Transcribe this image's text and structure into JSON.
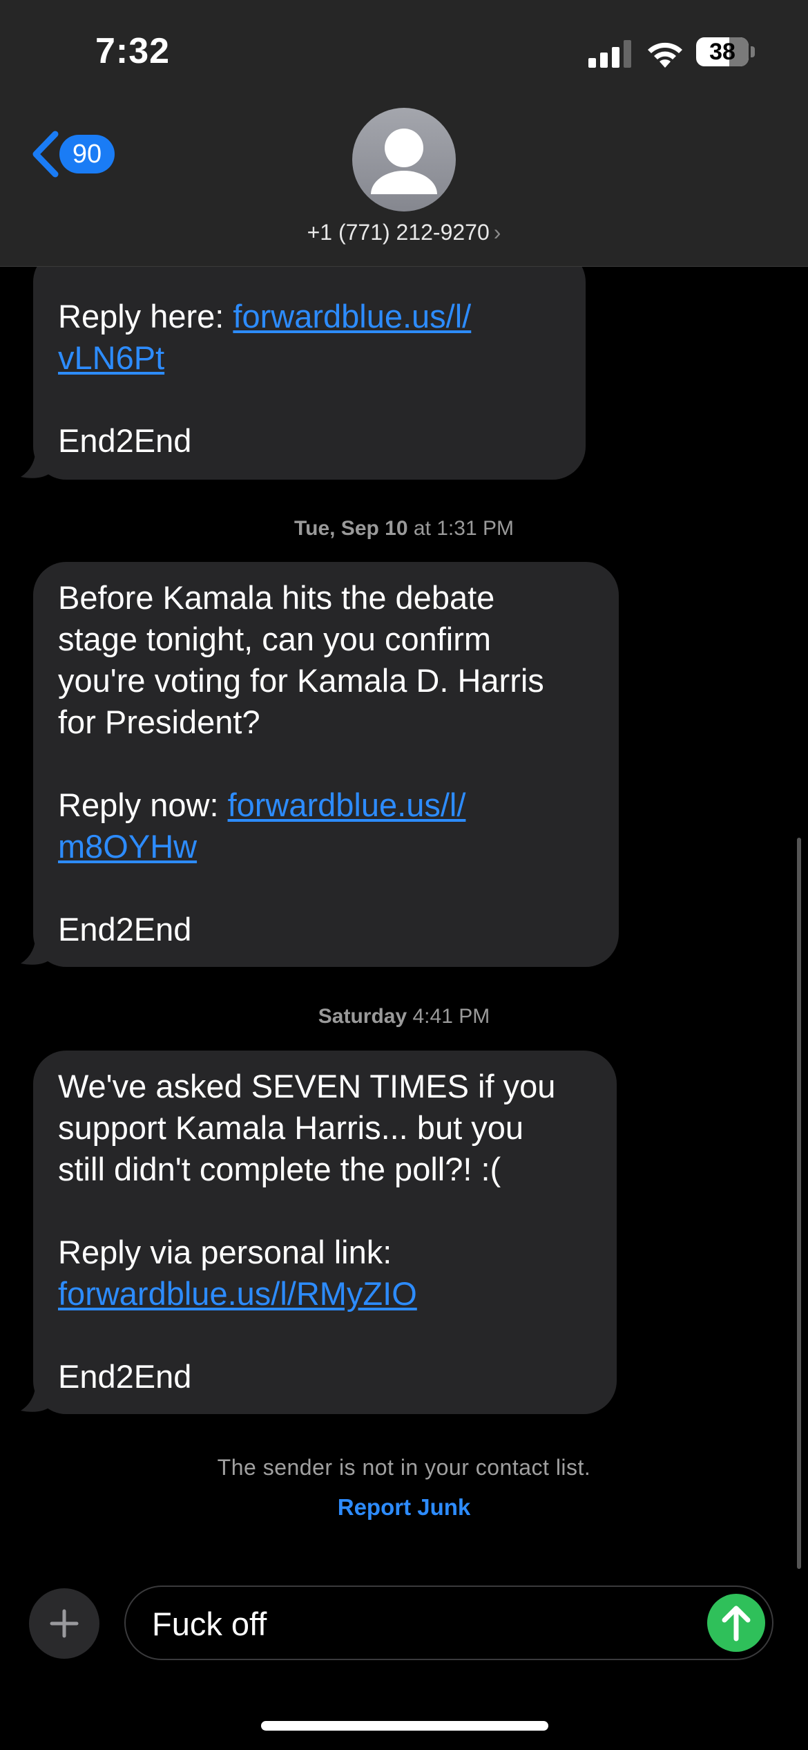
{
  "status_bar": {
    "time": "7:32",
    "battery": "38"
  },
  "header": {
    "back_badge": "90",
    "contact": "+1 (771) 212-9270",
    "contact_chevron": "›"
  },
  "messages": [
    {
      "lines": [
        {
          "text": "Reply here: ",
          "link": "forwardblue.us/l/"
        },
        {
          "link": "vLN6Pt"
        },
        {
          "text": ""
        },
        {
          "text": "End2End"
        }
      ]
    },
    {
      "timestamp_day": "Tue, Sep 10",
      "timestamp_time": " at 1:31 PM",
      "lines": [
        {
          "text": "Before Kamala hits the debate"
        },
        {
          "text": "stage tonight, can you confirm"
        },
        {
          "text": "you're voting for Kamala D. Harris"
        },
        {
          "text": "for President?"
        },
        {
          "text": ""
        },
        {
          "text": "Reply now: ",
          "link": "forwardblue.us/l/"
        },
        {
          "link": "m8OYHw"
        },
        {
          "text": ""
        },
        {
          "text": "End2End"
        }
      ]
    },
    {
      "timestamp_day": "Saturday",
      "timestamp_time": " 4:41 PM",
      "lines": [
        {
          "text": "We've asked SEVEN TIMES if you"
        },
        {
          "text": "support Kamala Harris... but you"
        },
        {
          "text": "still didn't complete the poll?! :("
        },
        {
          "text": ""
        },
        {
          "text": "Reply via personal link:"
        },
        {
          "link": "forwardblue.us/l/RMyZIO"
        },
        {
          "text": ""
        },
        {
          "text": "End2End"
        }
      ]
    }
  ],
  "notice": "The sender is not in your contact list.",
  "report_junk": "Report Junk",
  "composer": {
    "text": "Fuck off"
  },
  "icons": {
    "back": "chevron-left-icon",
    "avatar": "person-icon",
    "add": "plus-icon",
    "send": "arrow-up-icon",
    "signal": "signal-icon",
    "wifi": "wifi-icon",
    "battery": "battery-icon"
  },
  "colors": {
    "accent": "#2d8cff",
    "bubble": "#262628",
    "send": "#2fc05a",
    "header": "#262626"
  }
}
